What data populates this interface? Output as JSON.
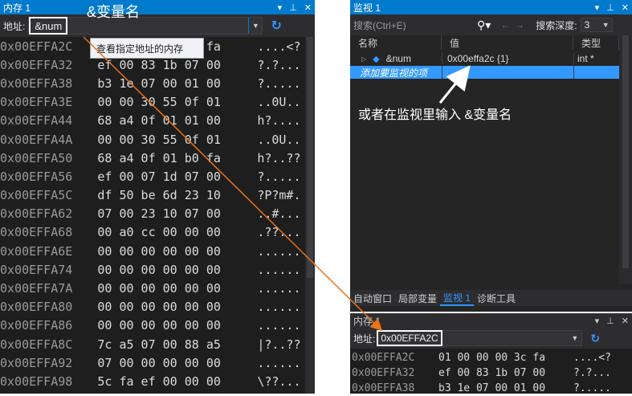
{
  "memory_left": {
    "title": "内存 1",
    "title_controls": [
      "▾",
      "⊐",
      "✕"
    ],
    "address_label": "地址:",
    "address_value": "&num",
    "rows": [
      {
        "addr": "0x00EFFA2C",
        "hex": "01 00 00 00 3c fa",
        "chars": "....<?"
      },
      {
        "addr": "0x00EFFA32",
        "hex": "ef 00 83 1b 07 00",
        "chars": "?.?..."
      },
      {
        "addr": "0x00EFFA38",
        "hex": "b3 1e 07 00 01 00",
        "chars": "?....."
      },
      {
        "addr": "0x00EFFA3E",
        "hex": "00 00 30 55 0f 01",
        "chars": "..0U.."
      },
      {
        "addr": "0x00EFFA44",
        "hex": "68 a4 0f 01 01 00",
        "chars": "h?...."
      },
      {
        "addr": "0x00EFFA4A",
        "hex": "00 00 30 55 0f 01",
        "chars": "..0U.."
      },
      {
        "addr": "0x00EFFA50",
        "hex": "68 a4 0f 01 b0 fa",
        "chars": "h?..??"
      },
      {
        "addr": "0x00EFFA56",
        "hex": "ef 00 07 1d 07 00",
        "chars": "?....."
      },
      {
        "addr": "0x00EFFA5C",
        "hex": "df 50 be 6d 23 10",
        "chars": "?P?m#."
      },
      {
        "addr": "0x00EFFA62",
        "hex": "07 00 23 10 07 00",
        "chars": "..#..."
      },
      {
        "addr": "0x00EFFA68",
        "hex": "00 a0 cc 00 00 00",
        "chars": ".??..."
      },
      {
        "addr": "0x00EFFA6E",
        "hex": "00 00 00 00 00 00",
        "chars": "......"
      },
      {
        "addr": "0x00EFFA74",
        "hex": "00 00 00 00 00 00",
        "chars": "......"
      },
      {
        "addr": "0x00EFFA7A",
        "hex": "00 00 00 00 00 00",
        "chars": "......"
      },
      {
        "addr": "0x00EFFA80",
        "hex": "00 00 00 00 00 00",
        "chars": "......"
      },
      {
        "addr": "0x00EFFA86",
        "hex": "00 00 00 00 00 00",
        "chars": "......"
      },
      {
        "addr": "0x00EFFA8C",
        "hex": "7c a5 07 00 88 a5",
        "chars": "|?..??"
      },
      {
        "addr": "0x00EFFA92",
        "hex": "07 00 00 00 00 00",
        "chars": "......"
      },
      {
        "addr": "0x00EFFA98",
        "hex": "5c fa ef 00 00 00",
        "chars": "\\??..."
      }
    ],
    "tooltip": "查看指定地址的内存",
    "annotation": "&变量名"
  },
  "watch": {
    "title": "监视 1",
    "title_controls": [
      "▾",
      "⊐",
      "✕"
    ],
    "search_placeholder": "搜索(Ctrl+E)",
    "search_depth_label": "搜索深度:",
    "search_depth_value": "3",
    "columns": {
      "name": "名称",
      "value": "值",
      "type": "类型"
    },
    "rows": [
      {
        "name": "&num",
        "value": "0x00effa2c {1}",
        "type": "int *"
      }
    ],
    "add_item_placeholder": "添加要监视的项",
    "annotation": "或者在监视里输入 &变量名",
    "tabs": [
      "自动窗口",
      "局部变量",
      "监视 1",
      "诊断工具"
    ],
    "active_tab": "监视 1"
  },
  "memory_right": {
    "title": "内存 1",
    "title_controls": [
      "▾",
      "⊐",
      "✕"
    ],
    "address_label": "地址:",
    "address_value": "0x00EFFA2C",
    "rows": [
      {
        "addr": "0x00EFFA2C",
        "hex": "01 00 00 00 3c fa",
        "chars": "....<?"
      },
      {
        "addr": "0x00EFFA32",
        "hex": "ef 00 83 1b 07 00",
        "chars": "?.?..."
      },
      {
        "addr": "0x00EFFA38",
        "hex": "b3 1e 07 00 01 00",
        "chars": "?....."
      }
    ]
  },
  "colors": {
    "accent": "#007acc",
    "arrow": "#e8731a",
    "selection": "#3399ff"
  }
}
